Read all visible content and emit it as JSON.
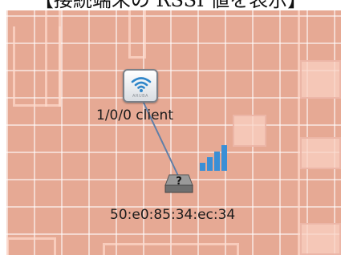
{
  "caption": "【接続端末の RSSI 値を表示】",
  "access_point": {
    "name": "1/0/0 client",
    "icon": "wifi-access-point-icon",
    "brand": "ARUBA"
  },
  "client": {
    "mac": "50:e0:85:34:ec:34",
    "icon": "unknown-device-icon",
    "status_glyph": "?"
  },
  "signal": {
    "icon": "signal-strength-icon",
    "level": 4,
    "max_level": 4,
    "color": "#3a8fd6"
  },
  "colors": {
    "floor": "#e6a994",
    "link": "#5f7fa8"
  }
}
